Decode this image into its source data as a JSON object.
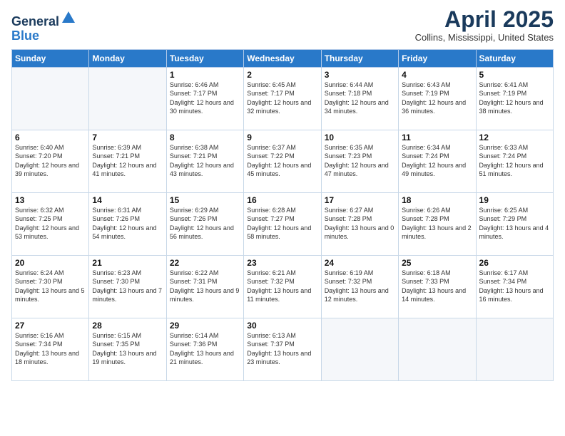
{
  "logo": {
    "general": "General",
    "blue": "Blue"
  },
  "header": {
    "title": "April 2025",
    "subtitle": "Collins, Mississippi, United States"
  },
  "weekdays": [
    "Sunday",
    "Monday",
    "Tuesday",
    "Wednesday",
    "Thursday",
    "Friday",
    "Saturday"
  ],
  "weeks": [
    [
      {
        "day": "",
        "info": ""
      },
      {
        "day": "",
        "info": ""
      },
      {
        "day": "1",
        "info": "Sunrise: 6:46 AM\nSunset: 7:17 PM\nDaylight: 12 hours and 30 minutes."
      },
      {
        "day": "2",
        "info": "Sunrise: 6:45 AM\nSunset: 7:17 PM\nDaylight: 12 hours and 32 minutes."
      },
      {
        "day": "3",
        "info": "Sunrise: 6:44 AM\nSunset: 7:18 PM\nDaylight: 12 hours and 34 minutes."
      },
      {
        "day": "4",
        "info": "Sunrise: 6:43 AM\nSunset: 7:19 PM\nDaylight: 12 hours and 36 minutes."
      },
      {
        "day": "5",
        "info": "Sunrise: 6:41 AM\nSunset: 7:19 PM\nDaylight: 12 hours and 38 minutes."
      }
    ],
    [
      {
        "day": "6",
        "info": "Sunrise: 6:40 AM\nSunset: 7:20 PM\nDaylight: 12 hours and 39 minutes."
      },
      {
        "day": "7",
        "info": "Sunrise: 6:39 AM\nSunset: 7:21 PM\nDaylight: 12 hours and 41 minutes."
      },
      {
        "day": "8",
        "info": "Sunrise: 6:38 AM\nSunset: 7:21 PM\nDaylight: 12 hours and 43 minutes."
      },
      {
        "day": "9",
        "info": "Sunrise: 6:37 AM\nSunset: 7:22 PM\nDaylight: 12 hours and 45 minutes."
      },
      {
        "day": "10",
        "info": "Sunrise: 6:35 AM\nSunset: 7:23 PM\nDaylight: 12 hours and 47 minutes."
      },
      {
        "day": "11",
        "info": "Sunrise: 6:34 AM\nSunset: 7:24 PM\nDaylight: 12 hours and 49 minutes."
      },
      {
        "day": "12",
        "info": "Sunrise: 6:33 AM\nSunset: 7:24 PM\nDaylight: 12 hours and 51 minutes."
      }
    ],
    [
      {
        "day": "13",
        "info": "Sunrise: 6:32 AM\nSunset: 7:25 PM\nDaylight: 12 hours and 53 minutes."
      },
      {
        "day": "14",
        "info": "Sunrise: 6:31 AM\nSunset: 7:26 PM\nDaylight: 12 hours and 54 minutes."
      },
      {
        "day": "15",
        "info": "Sunrise: 6:29 AM\nSunset: 7:26 PM\nDaylight: 12 hours and 56 minutes."
      },
      {
        "day": "16",
        "info": "Sunrise: 6:28 AM\nSunset: 7:27 PM\nDaylight: 12 hours and 58 minutes."
      },
      {
        "day": "17",
        "info": "Sunrise: 6:27 AM\nSunset: 7:28 PM\nDaylight: 13 hours and 0 minutes."
      },
      {
        "day": "18",
        "info": "Sunrise: 6:26 AM\nSunset: 7:28 PM\nDaylight: 13 hours and 2 minutes."
      },
      {
        "day": "19",
        "info": "Sunrise: 6:25 AM\nSunset: 7:29 PM\nDaylight: 13 hours and 4 minutes."
      }
    ],
    [
      {
        "day": "20",
        "info": "Sunrise: 6:24 AM\nSunset: 7:30 PM\nDaylight: 13 hours and 5 minutes."
      },
      {
        "day": "21",
        "info": "Sunrise: 6:23 AM\nSunset: 7:30 PM\nDaylight: 13 hours and 7 minutes."
      },
      {
        "day": "22",
        "info": "Sunrise: 6:22 AM\nSunset: 7:31 PM\nDaylight: 13 hours and 9 minutes."
      },
      {
        "day": "23",
        "info": "Sunrise: 6:21 AM\nSunset: 7:32 PM\nDaylight: 13 hours and 11 minutes."
      },
      {
        "day": "24",
        "info": "Sunrise: 6:19 AM\nSunset: 7:32 PM\nDaylight: 13 hours and 12 minutes."
      },
      {
        "day": "25",
        "info": "Sunrise: 6:18 AM\nSunset: 7:33 PM\nDaylight: 13 hours and 14 minutes."
      },
      {
        "day": "26",
        "info": "Sunrise: 6:17 AM\nSunset: 7:34 PM\nDaylight: 13 hours and 16 minutes."
      }
    ],
    [
      {
        "day": "27",
        "info": "Sunrise: 6:16 AM\nSunset: 7:34 PM\nDaylight: 13 hours and 18 minutes."
      },
      {
        "day": "28",
        "info": "Sunrise: 6:15 AM\nSunset: 7:35 PM\nDaylight: 13 hours and 19 minutes."
      },
      {
        "day": "29",
        "info": "Sunrise: 6:14 AM\nSunset: 7:36 PM\nDaylight: 13 hours and 21 minutes."
      },
      {
        "day": "30",
        "info": "Sunrise: 6:13 AM\nSunset: 7:37 PM\nDaylight: 13 hours and 23 minutes."
      },
      {
        "day": "",
        "info": ""
      },
      {
        "day": "",
        "info": ""
      },
      {
        "day": "",
        "info": ""
      }
    ]
  ]
}
